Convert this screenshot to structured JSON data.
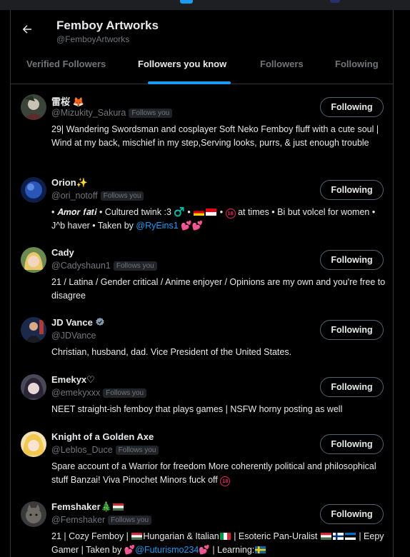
{
  "header": {
    "title": "Femboy Artworks",
    "handle": "@FemboyArtworks"
  },
  "tabs": [
    {
      "label": "Verified Followers"
    },
    {
      "label": "Followers you know"
    },
    {
      "label": "Followers"
    },
    {
      "label": "Following"
    }
  ],
  "follows_you_label": "Follows you",
  "users": [
    {
      "name": "雷桜 🦊",
      "handle": "@Mizukity_Sakura",
      "button": "Following",
      "bio": "29| Wandering Swordsman and cosplayer Soft Neko Femboy fluff with a cute soul | Wind at my back, mischief in my step,Serving looks, purrs, & just enough trouble"
    },
    {
      "name": "Orion✨",
      "handle": "@ori_notoff",
      "button": "Following",
      "bio_parts": [
        "• 𝑨𝒎𝒐𝒓 𝒇𝒂𝒕𝒊 • Cultured twink :3 ♂️ • ",
        " • ",
        " at times • Bi but volcel for women • J^b haver • Taken by ",
        "@RyEins1",
        " 💕💕"
      ],
      "badge": "18"
    },
    {
      "name": "Cady",
      "handle": "@Cadyshaun1",
      "button": "Following",
      "bio": "21 / Latina / Gender critical / Anime enjoyer / Opinions are my own and you're free to disagree"
    },
    {
      "name": "JD Vance",
      "handle": "@JDVance",
      "button": "Following",
      "bio": "Christian, husband, dad. Vice President of the United States."
    },
    {
      "name": "Emekyx♡",
      "handle": "@emekyxxx",
      "button": "Following",
      "bio": "NEET straight-ish femboy that plays games | NSFW horny posting as well"
    },
    {
      "name": "Knight of a Golden Axe",
      "handle": "@Leblos_Duce",
      "button": "Following",
      "bio": "Spare account of a Warrior for freedom More coherently political and philosophical stuff Banzai! Viva Pinochet Minors fuck off"
    },
    {
      "name": "Femshaker🎄",
      "handle": "@Femshaker",
      "button": "Following",
      "bio_parts": [
        "21 | Cozy Femboy | ",
        "Hungarian & Italian",
        " | Esoteric Pan-Uralist ",
        " | Eepy Gamer | Taken by 💕",
        "@Futurismo234",
        "💕 | Learning:"
      ]
    }
  ],
  "colors": {
    "accent": "#1d9bf0",
    "background": "#000000",
    "muted_text": "#71767b",
    "border": "#2f3336"
  }
}
